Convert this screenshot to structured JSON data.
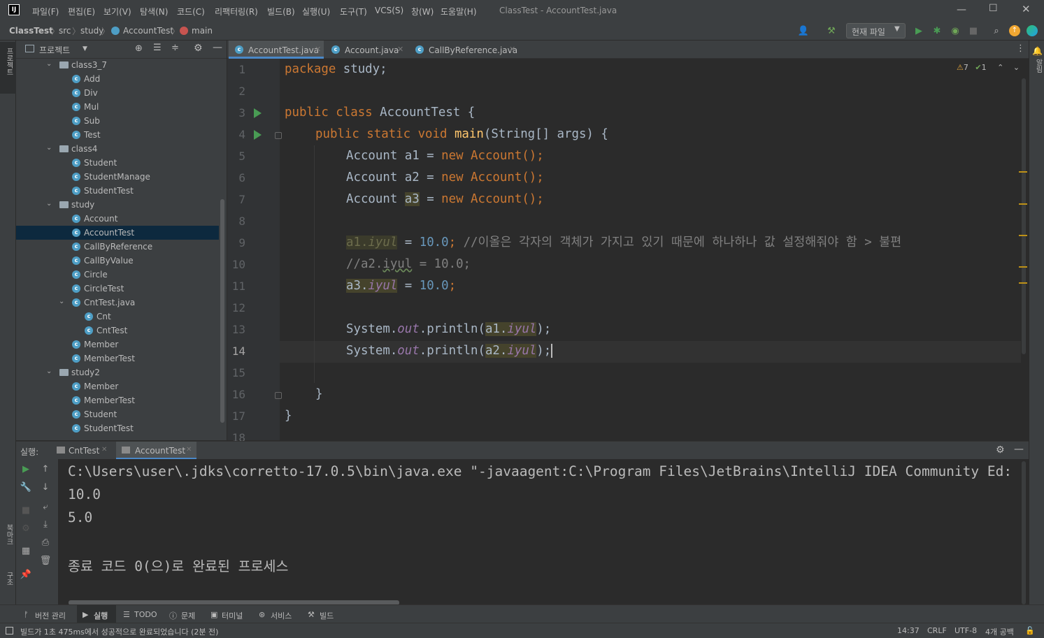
{
  "menu": {
    "items": [
      "파일(F)",
      "편집(E)",
      "보기(V)",
      "탐색(N)",
      "코드(C)",
      "리팩터링(R)",
      "빌드(B)",
      "실행(U)",
      "도구(T)",
      "VCS(S)",
      "창(W)",
      "도움말(H)"
    ],
    "window_title": "ClassTest - AccountTest.java"
  },
  "breadcrumb": [
    "ClassTest",
    "src",
    "study",
    "AccountTest",
    "main"
  ],
  "toolbar": {
    "run_config": "현재 파일"
  },
  "project": {
    "title": "프로젝트",
    "tree": [
      {
        "label": "class3_7",
        "kind": "folder",
        "depth": 0,
        "open": true
      },
      {
        "label": "Add",
        "kind": "class",
        "depth": 1
      },
      {
        "label": "Div",
        "kind": "class",
        "depth": 1
      },
      {
        "label": "Mul",
        "kind": "class",
        "depth": 1
      },
      {
        "label": "Sub",
        "kind": "class",
        "depth": 1
      },
      {
        "label": "Test",
        "kind": "class",
        "depth": 1
      },
      {
        "label": "class4",
        "kind": "folder",
        "depth": 0,
        "open": true
      },
      {
        "label": "Student",
        "kind": "class",
        "depth": 1
      },
      {
        "label": "StudentManage",
        "kind": "class",
        "depth": 1
      },
      {
        "label": "StudentTest",
        "kind": "class",
        "depth": 1
      },
      {
        "label": "study",
        "kind": "folder",
        "depth": 0,
        "open": true
      },
      {
        "label": "Account",
        "kind": "class",
        "depth": 1
      },
      {
        "label": "AccountTest",
        "kind": "class",
        "depth": 1,
        "selected": true
      },
      {
        "label": "CallByReference",
        "kind": "class",
        "depth": 1
      },
      {
        "label": "CallByValue",
        "kind": "class",
        "depth": 1
      },
      {
        "label": "Circle",
        "kind": "class",
        "depth": 1
      },
      {
        "label": "CircleTest",
        "kind": "class",
        "depth": 1
      },
      {
        "label": "CntTest.java",
        "kind": "file",
        "depth": 1,
        "open": true
      },
      {
        "label": "Cnt",
        "kind": "class",
        "depth": 2
      },
      {
        "label": "CntTest",
        "kind": "class",
        "depth": 2
      },
      {
        "label": "Member",
        "kind": "class",
        "depth": 1
      },
      {
        "label": "MemberTest",
        "kind": "class",
        "depth": 1
      },
      {
        "label": "study2",
        "kind": "folder",
        "depth": 0,
        "open": true
      },
      {
        "label": "Member",
        "kind": "class",
        "depth": 1
      },
      {
        "label": "MemberTest",
        "kind": "class",
        "depth": 1
      },
      {
        "label": "Student",
        "kind": "class",
        "depth": 1
      },
      {
        "label": "StudentTest",
        "kind": "class",
        "depth": 1
      }
    ]
  },
  "editor_tabs": [
    {
      "label": "AccountTest.java",
      "active": true
    },
    {
      "label": "Account.java",
      "active": false
    },
    {
      "label": "CallByReference.java",
      "active": false
    }
  ],
  "inspections": {
    "warnings": "7",
    "ok": "1"
  },
  "line_numbers": [
    "1",
    "2",
    "3",
    "4",
    "5",
    "6",
    "7",
    "8",
    "9",
    "10",
    "11",
    "12",
    "13",
    "14",
    "15",
    "16",
    "17",
    "18"
  ],
  "code": {
    "l1_kw": "package",
    "l1_rest": " study;",
    "l3_kw": "public class",
    "l3_rest": " AccountTest {",
    "l4_kw": "public static void",
    "l4_fn": "main",
    "l4_rest": "(String[] args) {",
    "l5a": "Account a1 = ",
    "l5_new": "new",
    "l5b": " Account();",
    "l6a": "Account a2 = ",
    "l6_new": "new",
    "l6b": " Account();",
    "l7a": "Account ",
    "l7_var": "a3",
    "l7b": " = ",
    "l7_new": "new",
    "l7c": " Account();",
    "l9_obj": "a1.",
    "l9_fld": "iyul",
    "l9_eq": " = ",
    "l9_num": "10.0",
    "l9_semi": "; ",
    "l9_cmt": "//이올은 각자의 객체가 가지고 있기 때문에 하나하나 값 설정해줘야 함 > 불편",
    "l10_a": "//a2.",
    "l10_fld": "iyul",
    "l10_b": " = 10.0;",
    "l11_obj": "a3.",
    "l11_fld": "iyul",
    "l11_eq": " = ",
    "l11_num": "10.0",
    "l11_semi": ";",
    "l13_a": "System.",
    "l13_out": "out",
    "l13_b": ".println(",
    "l13_obj": "a1.",
    "l13_fld": "iyul",
    "l13_c": ");",
    "l14_a": "System.",
    "l14_out": "out",
    "l14_b": ".println(",
    "l14_obj": "a2.",
    "l14_fld": "iyul",
    "l14_c": ");",
    "l16": "}",
    "l17": "}"
  },
  "run": {
    "label": "실행:",
    "tabs": [
      "CntTest",
      "AccountTest"
    ],
    "console": [
      "C:\\Users\\user\\.jdks\\corretto-17.0.5\\bin\\java.exe \"-javaagent:C:\\Program Files\\JetBrains\\IntelliJ IDEA Community Ed:",
      "10.0",
      "5.0",
      "",
      "종료 코드 0(으)로 완료된 프로세스"
    ]
  },
  "toolwindows": [
    "버전 관리",
    "실행",
    "TODO",
    "문제",
    "터미널",
    "서비스",
    "빌드"
  ],
  "status": {
    "message": "빌드가 1초 475ms에서 성공적으로 완료되었습니다 (2분 전)",
    "position": "14:37",
    "line_sep": "CRLF",
    "encoding": "UTF-8",
    "indent": "4개 공백"
  },
  "side_labels": {
    "project": "프로젝트",
    "bookmarks": "북마크",
    "structure": "구조",
    "notifications": "알림"
  },
  "colors": {
    "keyword": "#cc7832",
    "number": "#6897bb",
    "comment": "#808080",
    "field": "#9876aa",
    "function": "#ffc66d",
    "accent": "#4a88c7",
    "run_green": "#499c54"
  }
}
